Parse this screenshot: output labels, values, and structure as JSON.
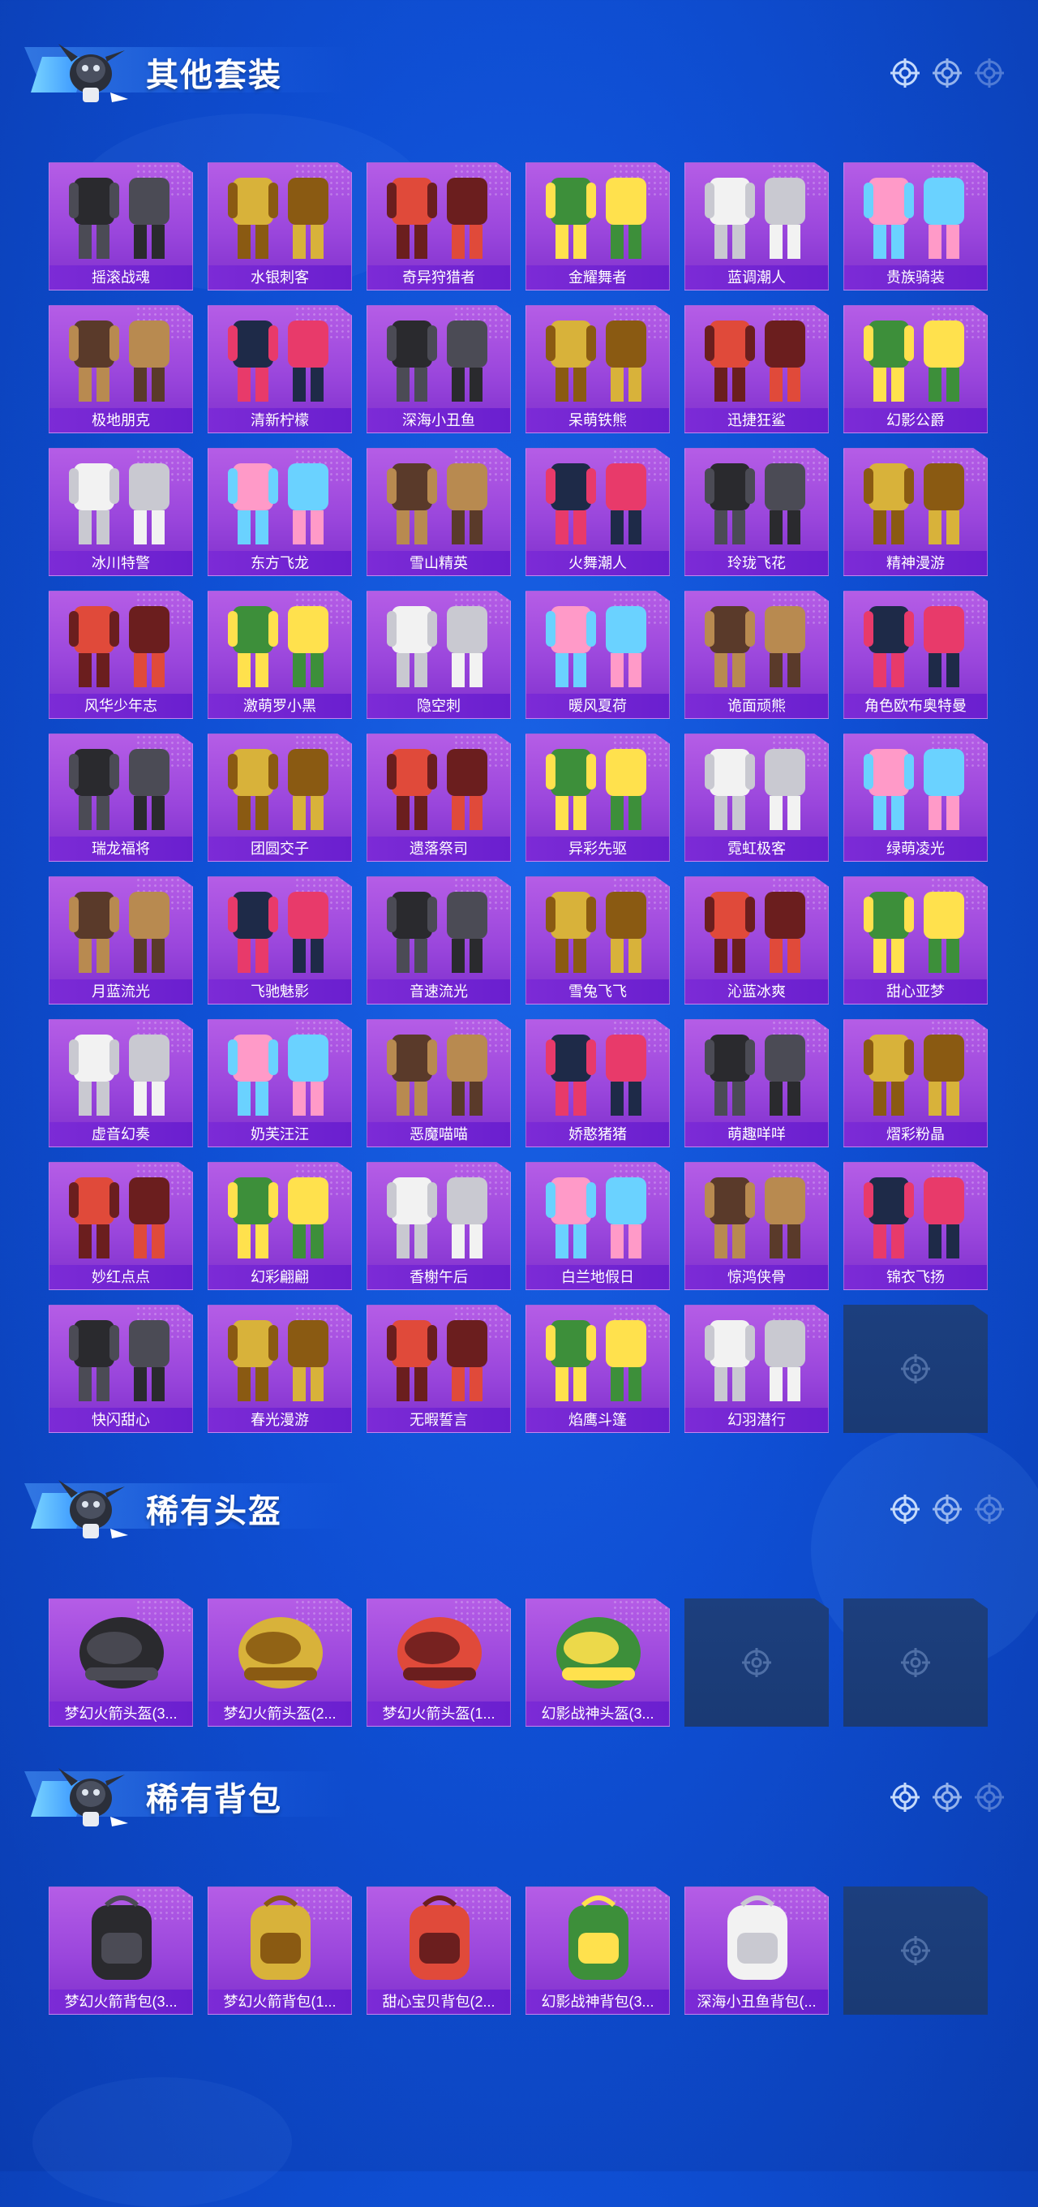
{
  "sections": [
    {
      "title": "其他套装",
      "items": [
        "摇滚战魂",
        "水银刺客",
        "奇异狩猎者",
        "金耀舞者",
        "蓝调潮人",
        "贵族骑装",
        "极地朋克",
        "清新柠檬",
        "深海小丑鱼",
        "呆萌铁熊",
        "迅捷狂鲨",
        "幻影公爵",
        "冰川特警",
        "东方飞龙",
        "雪山精英",
        "火舞潮人",
        "玲珑飞花",
        "精神漫游",
        "风华少年志",
        "激萌罗小黑",
        "隐空刺",
        "暖风夏荷",
        "诡面顽熊",
        "角色欧布奥特曼",
        "瑞龙福将",
        "团圆交子",
        "遗落祭司",
        "异彩先驱",
        "霓虹极客",
        "绿萌凌光",
        "月蓝流光",
        "飞驰魅影",
        "音速流光",
        "雪兔飞飞",
        "沁蓝冰爽",
        "甜心亚梦",
        "虚音幻奏",
        "奶芙汪汪",
        "恶魔喵喵",
        "娇憨猪猪",
        "萌趣咩咩",
        "熠彩粉晶",
        "妙红点点",
        "幻彩翩翩",
        "香榭午后",
        "白兰地假日",
        "惊鸿侠骨",
        "锦衣飞扬",
        "快闪甜心",
        "春光漫游",
        "无暇誓言",
        "焰鹰斗篷",
        "幻羽潜行"
      ],
      "empty_slots": 1
    },
    {
      "title": "稀有头盔",
      "items": [
        "梦幻火箭头盔(3...",
        "梦幻火箭头盔(2...",
        "梦幻火箭头盔(1...",
        "幻影战神头盔(3..."
      ],
      "empty_slots": 2
    },
    {
      "title": "稀有背包",
      "items": [
        "梦幻火箭背包(3...",
        "梦幻火箭背包(1...",
        "甜心宝贝背包(2...",
        "幻影战神背包(3...",
        "深海小丑鱼背包(..."
      ],
      "empty_slots": 1
    }
  ],
  "colors": {
    "card_top": "#b55de6",
    "card_label": "#7c2bd6",
    "empty_slot": "#1c3f7e",
    "background": "#0f4fd4"
  }
}
